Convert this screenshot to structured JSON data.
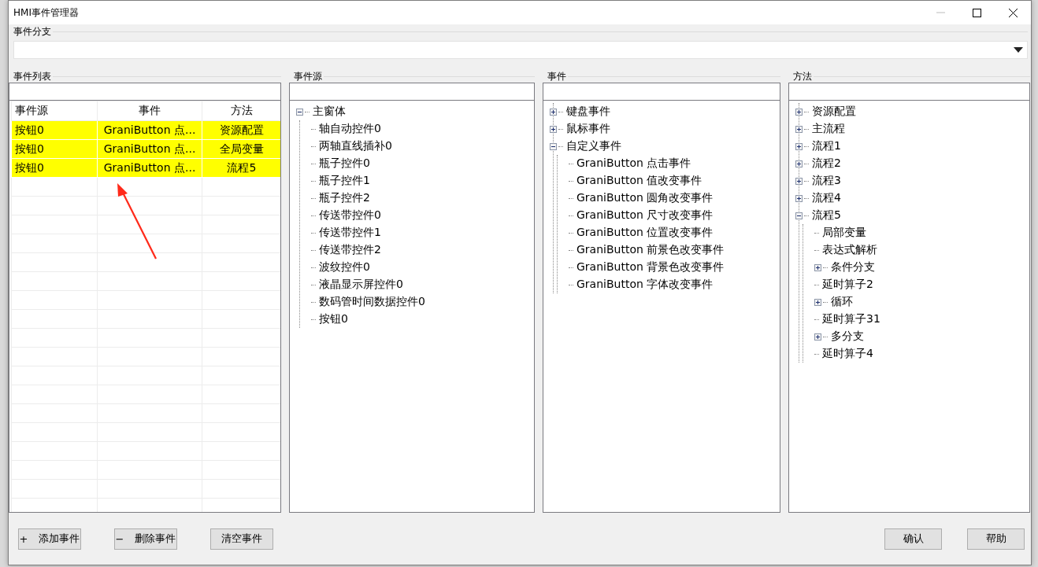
{
  "window": {
    "title": "HMI事件管理器"
  },
  "branch_group": {
    "label": "事件分支"
  },
  "event_list": {
    "label": "事件列表",
    "columns": [
      "事件源",
      "事件",
      "方法"
    ],
    "rows": [
      {
        "cells": [
          "按钮0",
          "GraniButton 点...",
          "资源配置"
        ],
        "highlighted": true
      },
      {
        "cells": [
          "按钮0",
          "GraniButton 点...",
          "全局变量"
        ],
        "highlighted": true
      },
      {
        "cells": [
          "按钮0",
          "GraniButton 点...",
          "流程5"
        ],
        "highlighted": true
      }
    ]
  },
  "tree_panels": [
    {
      "label": "事件源",
      "tree": [
        {
          "label": "主窗体",
          "expanded": true,
          "children": [
            {
              "label": "轴自动控件0"
            },
            {
              "label": "两轴直线插补0"
            },
            {
              "label": "瓶子控件0"
            },
            {
              "label": "瓶子控件1"
            },
            {
              "label": "瓶子控件2"
            },
            {
              "label": "传送带控件0"
            },
            {
              "label": "传送带控件1"
            },
            {
              "label": "传送带控件2"
            },
            {
              "label": "波纹控件0"
            },
            {
              "label": "液晶显示屏控件0"
            },
            {
              "label": "数码管时间数据控件0"
            },
            {
              "label": "按钮0"
            }
          ]
        }
      ]
    },
    {
      "label": "事件",
      "tree": [
        {
          "label": "键盘事件",
          "expanded": false
        },
        {
          "label": "鼠标事件",
          "expanded": false
        },
        {
          "label": "自定义事件",
          "expanded": true,
          "children": [
            {
              "label": "GraniButton 点击事件"
            },
            {
              "label": "GraniButton 值改变事件"
            },
            {
              "label": "GraniButton 圆角改变事件"
            },
            {
              "label": "GraniButton 尺寸改变事件"
            },
            {
              "label": "GraniButton 位置改变事件"
            },
            {
              "label": "GraniButton 前景色改变事件"
            },
            {
              "label": "GraniButton 背景色改变事件"
            },
            {
              "label": "GraniButton 字体改变事件"
            }
          ]
        }
      ]
    },
    {
      "label": "方法",
      "tree": [
        {
          "label": "资源配置",
          "expanded": false
        },
        {
          "label": "主流程",
          "expanded": false
        },
        {
          "label": "流程1",
          "expanded": false
        },
        {
          "label": "流程2",
          "expanded": false
        },
        {
          "label": "流程3",
          "expanded": false
        },
        {
          "label": "流程4",
          "expanded": false
        },
        {
          "label": "流程5",
          "expanded": true,
          "children": [
            {
              "label": "局部变量"
            },
            {
              "label": "表达式解析"
            },
            {
              "label": "条件分支",
              "expanded": false
            },
            {
              "label": "延时算子2"
            },
            {
              "label": "循环",
              "expanded": false
            },
            {
              "label": "延时算子31"
            },
            {
              "label": "多分支",
              "expanded": false
            },
            {
              "label": "延时算子4"
            }
          ]
        }
      ]
    }
  ],
  "left_buttons": [
    {
      "symbol": "+",
      "label": "添加事件"
    },
    {
      "symbol": "−",
      "label": "删除事件"
    },
    {
      "label": "清空事件"
    }
  ],
  "right_buttons": [
    "确认",
    "帮助"
  ]
}
